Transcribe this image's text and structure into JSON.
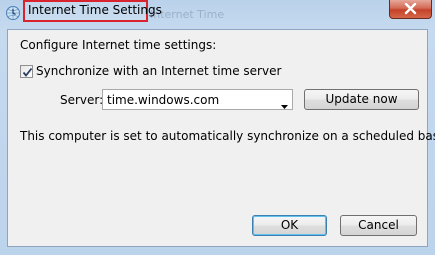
{
  "window": {
    "title": "Internet Time Settings",
    "background_title": "Internet Time",
    "title_icon": "clock-globe-icon",
    "close_icon": "close-icon"
  },
  "content": {
    "heading": "Configure Internet time settings:",
    "sync_checkbox": {
      "label": "Synchronize with an Internet time server",
      "checked": true
    },
    "server_label": "Server:",
    "server_value": "time.windows.com",
    "update_button": "Update now",
    "info_text": "This computer is set to automatically synchronize on a scheduled basis.",
    "ok_button": "OK",
    "cancel_button": "Cancel"
  },
  "colors": {
    "highlight": "#d9232e",
    "frame": "#b9d1ea",
    "close": "#c5412a"
  }
}
